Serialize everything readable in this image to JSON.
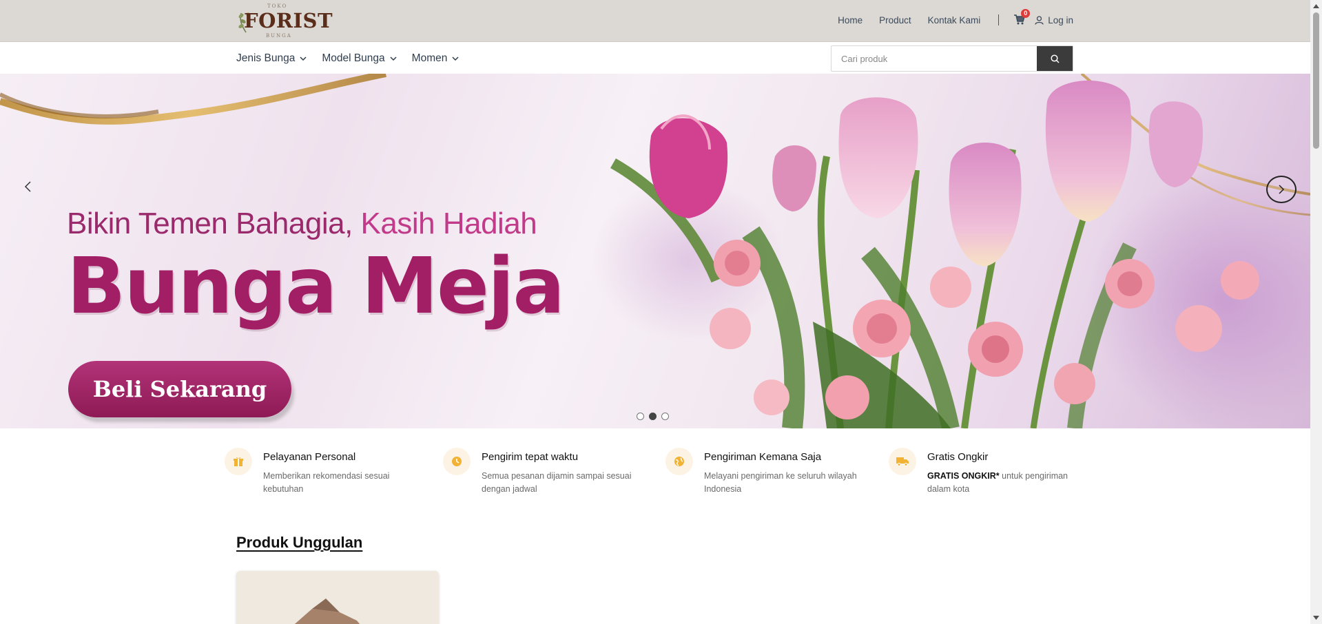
{
  "header": {
    "logo": {
      "top": "TOKO",
      "main": "FORIST",
      "bottom": "BUNGA"
    },
    "nav": [
      "Home",
      "Product",
      "Kontak Kami"
    ],
    "cart_count": "0",
    "login_label": "Log in"
  },
  "subnav": {
    "menu": [
      "Jenis Bunga",
      "Model Bunga",
      "Momen"
    ],
    "search_placeholder": "Cari produk"
  },
  "hero": {
    "headline_part1": "Bikin Temen Bahagia,",
    "headline_part2": "Kasih Hadiah",
    "title": "Bunga Meja",
    "cta": "Beli Sekarang",
    "slide_count": 3,
    "active_slide": 2,
    "colors": {
      "primary": "#a31f65",
      "accent": "#c23a8a"
    }
  },
  "features": [
    {
      "icon": "gift-icon",
      "title": "Pelayanan Personal",
      "desc": "Memberikan rekomendasi sesuai kebutuhan"
    },
    {
      "icon": "clock-icon",
      "title": "Pengirim tepat waktu",
      "desc": "Semua pesanan dijamin sampai sesuai dengan jadwal"
    },
    {
      "icon": "globe-icon",
      "title": "Pengiriman Kemana Saja",
      "desc": "Melayani pengiriman ke seluruh wilayah Indonesia"
    },
    {
      "icon": "truck-icon",
      "title": "Gratis Ongkir",
      "desc_bold": "GRATIS ONGKIR*",
      "desc": " untuk pengiriman dalam kota"
    }
  ],
  "section": {
    "title": "Produk Unggulan"
  },
  "icon_color": "#f2b233"
}
